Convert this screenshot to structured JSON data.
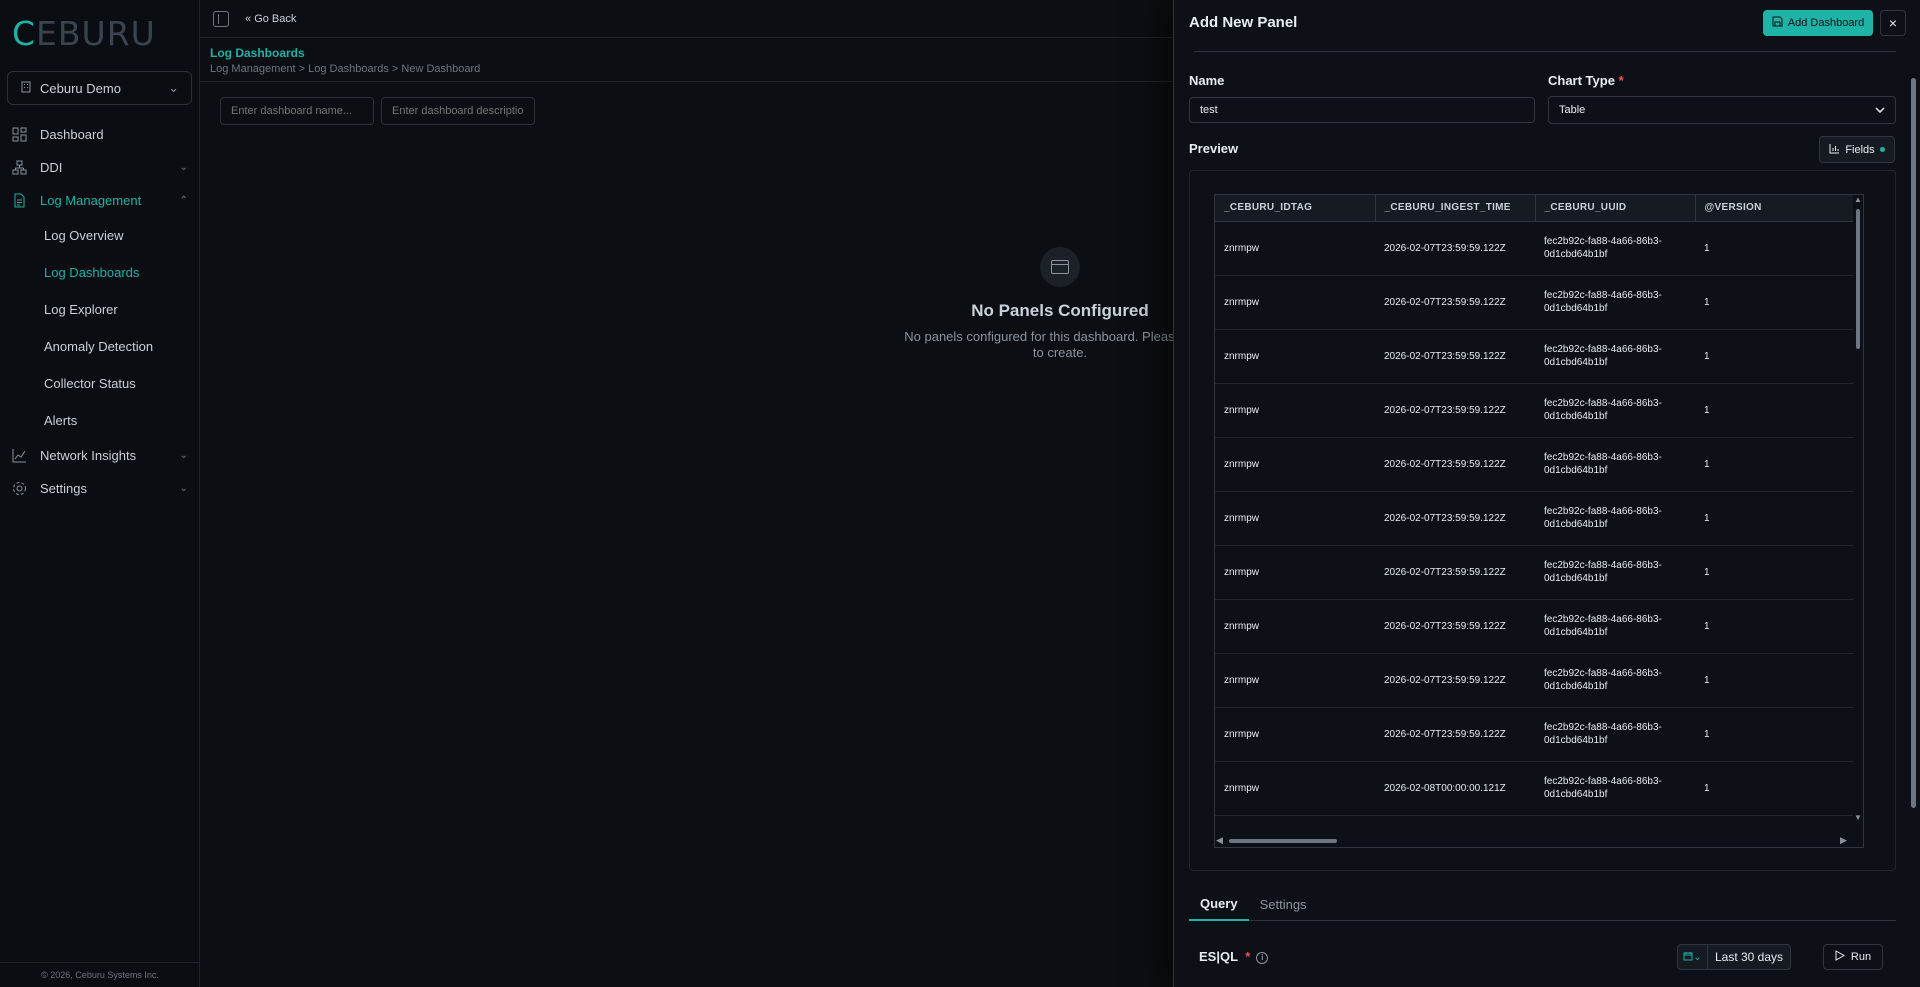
{
  "sidebar": {
    "logo_prefix": "C",
    "logo_rest": "EBURU",
    "org": "Ceburu Demo",
    "items": [
      {
        "label": "Dashboard"
      },
      {
        "label": "DDI"
      },
      {
        "label": "Log Management"
      },
      {
        "label": "Network Insights"
      },
      {
        "label": "Settings"
      }
    ],
    "sub_items": [
      {
        "label": "Log Overview"
      },
      {
        "label": "Log Dashboards"
      },
      {
        "label": "Log Explorer"
      },
      {
        "label": "Anomaly Detection"
      },
      {
        "label": "Collector Status"
      },
      {
        "label": "Alerts"
      }
    ],
    "footer": "© 2026, Ceburu Systems Inc."
  },
  "topbar": {
    "go_back": "Go Back"
  },
  "page": {
    "title": "Log Dashboards",
    "breadcrumb": "Log Management > Log Dashboards > New Dashboard",
    "name_placeholder": "Enter dashboard name...",
    "description_placeholder": "Enter dashboard description",
    "empty_title": "No Panels Configured",
    "empty_text_1": "No panels configured for this dashboard. Please selec",
    "empty_text_2": "to create."
  },
  "panel": {
    "title": "Add New Panel",
    "add_button": "Add Dashboard",
    "close_icon": "×",
    "name_label": "Name",
    "name_value": "test",
    "chart_type_label": "Chart Type",
    "required_mark": "*",
    "chart_type_value": "Table",
    "preview_label": "Preview",
    "fields_button": "Fields",
    "table": {
      "columns": [
        "_CEBURU_IDTAG",
        "_CEBURU_INGEST_TIME",
        "_CEBURU_UUID",
        "@VERSION"
      ],
      "rows": [
        [
          "znrmpw",
          "2026-02-07T23:59:59.122Z",
          "fec2b92c-fa88-4a66-86b3-0d1cbd64b1bf",
          "1"
        ],
        [
          "znrmpw",
          "2026-02-07T23:59:59.122Z",
          "fec2b92c-fa88-4a66-86b3-0d1cbd64b1bf",
          "1"
        ],
        [
          "znrmpw",
          "2026-02-07T23:59:59.122Z",
          "fec2b92c-fa88-4a66-86b3-0d1cbd64b1bf",
          "1"
        ],
        [
          "znrmpw",
          "2026-02-07T23:59:59.122Z",
          "fec2b92c-fa88-4a66-86b3-0d1cbd64b1bf",
          "1"
        ],
        [
          "znrmpw",
          "2026-02-07T23:59:59.122Z",
          "fec2b92c-fa88-4a66-86b3-0d1cbd64b1bf",
          "1"
        ],
        [
          "znrmpw",
          "2026-02-07T23:59:59.122Z",
          "fec2b92c-fa88-4a66-86b3-0d1cbd64b1bf",
          "1"
        ],
        [
          "znrmpw",
          "2026-02-07T23:59:59.122Z",
          "fec2b92c-fa88-4a66-86b3-0d1cbd64b1bf",
          "1"
        ],
        [
          "znrmpw",
          "2026-02-07T23:59:59.122Z",
          "fec2b92c-fa88-4a66-86b3-0d1cbd64b1bf",
          "1"
        ],
        [
          "znrmpw",
          "2026-02-07T23:59:59.122Z",
          "fec2b92c-fa88-4a66-86b3-0d1cbd64b1bf",
          "1"
        ],
        [
          "znrmpw",
          "2026-02-07T23:59:59.122Z",
          "fec2b92c-fa88-4a66-86b3-0d1cbd64b1bf",
          "1"
        ],
        [
          "znrmpw",
          "2026-02-08T00:00:00.121Z",
          "fec2b92c-fa88-4a66-86b3-0d1cbd64b1bf",
          "1"
        ]
      ]
    },
    "tabs": [
      {
        "label": "Query"
      },
      {
        "label": "Settings"
      }
    ],
    "esql_label_1": "ES",
    "esql_label_2": "QL",
    "date_range": "Last 30 days",
    "run_button": "Run"
  },
  "colors": {
    "accent": "#1fb2a6",
    "background": "#0b0e12",
    "panel": "#0d1117"
  }
}
